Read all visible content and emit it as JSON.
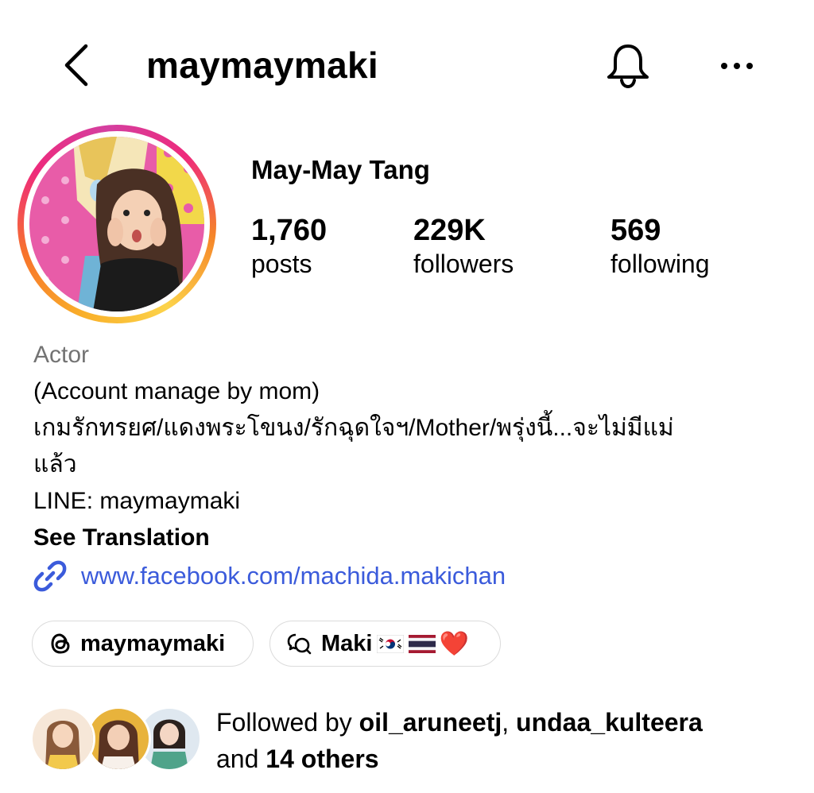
{
  "header": {
    "username": "maymaymaki",
    "back_icon": "chevron-left-icon",
    "bell_icon": "bell-icon",
    "more_icon": "more-horizontal-icon"
  },
  "profile": {
    "display_name": "May-May Tang"
  },
  "stats": {
    "posts": {
      "value": "1,760",
      "label": "posts"
    },
    "followers": {
      "value": "229K",
      "label": "followers"
    },
    "following": {
      "value": "569",
      "label": "following"
    }
  },
  "bio": {
    "category": "Actor",
    "line1": "(Account manage by mom)",
    "line2": "เกมรักทรยศ/แดงพระโขนง/รักฉุดใจฯ/Mother/พรุ่งนี้...จะไม่มีแม่",
    "line3": "แล้ว",
    "line4": "LINE: maymaymaki",
    "see_translation": "See Translation",
    "link": "www.facebook.com/machida.makichan"
  },
  "chips": {
    "threads": {
      "label": "maymaymaki",
      "icon": "threads-icon"
    },
    "channel": {
      "label": "Maki",
      "icon": "broadcast-channel-icon",
      "suffix": "❤️"
    }
  },
  "followed_by": {
    "prefix": "Followed by ",
    "user1": "oil_aruneetj",
    "sep": ", ",
    "user2": "undaa_kulteera",
    "and": "and ",
    "others": "14 others"
  },
  "colors": {
    "link": "#3b5bdb",
    "muted": "#737373",
    "border": "#dbdbdb"
  }
}
